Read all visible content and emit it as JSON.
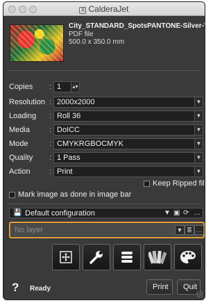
{
  "window": {
    "title": "CalderaJet"
  },
  "file": {
    "name": "City_STANDARD_SpotsPANTONE-Silver-White-V",
    "type": "PDF file",
    "size": "500.0 x 350.0 mm"
  },
  "settings": {
    "copies": {
      "label": "Copies",
      "value": "1"
    },
    "resolution": {
      "label": "Resolution",
      "value": "2000x2000"
    },
    "loading": {
      "label": "Loading",
      "value": "Roll 36"
    },
    "media": {
      "label": "Media",
      "value": "DoICC"
    },
    "mode": {
      "label": "Mode",
      "value": "CMYKRGBOCMYK"
    },
    "quality": {
      "label": "Quality",
      "value": "1 Pass"
    },
    "action": {
      "label": "Action",
      "value": "Print"
    }
  },
  "options": {
    "keep_ripped": {
      "label": "Keep Ripped file",
      "checked": false
    },
    "mark_done": {
      "label": "Mark image as done in image bar",
      "checked": false
    }
  },
  "configuration": {
    "value": "Default configuration"
  },
  "layer": {
    "placeholder": "No layer"
  },
  "tools": [
    {
      "name": "layout-tool",
      "icon": "move-layout-icon"
    },
    {
      "name": "settings-tool",
      "icon": "wrench-icon"
    },
    {
      "name": "queue-tool",
      "icon": "stack-icon"
    },
    {
      "name": "color-swatch-tool",
      "icon": "swatch-fan-icon"
    },
    {
      "name": "palette-tool",
      "icon": "palette-icon"
    }
  ],
  "footer": {
    "help": "?",
    "status": "Ready",
    "print_label": "Print",
    "quit_label": "Quit"
  },
  "colors": {
    "accent": "#e1a13a",
    "background": "#3a3a3a",
    "field": "#1f1f1f"
  }
}
